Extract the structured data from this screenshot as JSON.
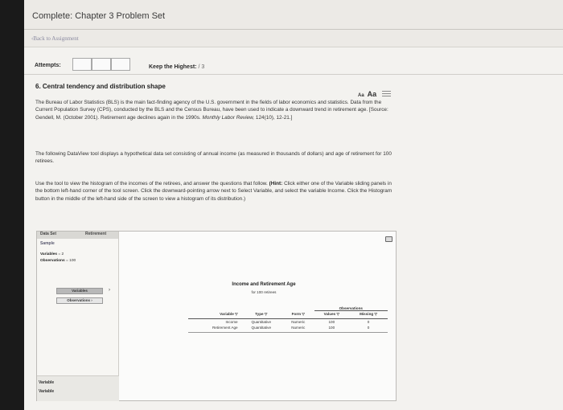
{
  "page": {
    "title": "Complete: Chapter 3 Problem Set",
    "back_link": "Back to Assignment"
  },
  "attempts": {
    "label": "Attempts:",
    "keep_label": "Keep the Highest:",
    "keep_value": "/ 3"
  },
  "question": {
    "title": "6. Central tendency and distribution shape",
    "font_small": "Aa",
    "font_big": "Aa",
    "p1_a": "The Bureau of Labor Statistics (BLS) is the main fact-finding agency of the U.S. government in the fields of labor economics and statistics. Data from the Current Population Survey (CPS), conducted by the BLS and the Census Bureau, have been used to indicate a downward trend in retirement age. [Source: Gendell, M. (October 2001). Retirement age declines again in the 1990s.",
    "p1_journal": "Monthly Labor Review,",
    "p1_b": "124(10), 12-21.]",
    "p2": "The following DataView tool displays a hypothetical data set consisting of annual income (as measured in thousands of dollars) and age of retirement for 100 retirees.",
    "p3_a": "Use the tool to view the histogram of the incomes of the retirees, and answer the questions that follow.",
    "p3_hint": "(Hint:",
    "p3_b": "Click either one of the Variable sliding panels in the bottom left-hand corner of the tool screen. Click the downward-pointing arrow next to Select Variable, and select the variable Income. Click the Histogram button in the middle of the left-hand side of the screen to view a histogram of its distribution.)"
  },
  "dataview": {
    "tab_dataset": "Data Set",
    "tab_retirement": "Retirement",
    "sample_label": "Sample",
    "variables_label": "Variables",
    "variables_value": "= 2",
    "observations_label": "Observations",
    "observations_value": "= 100",
    "btn_variables": "Variables",
    "btn_observations": "Observations",
    "arrow": "›",
    "variable_panel_1": "Variable",
    "variable_panel_2": "Variable",
    "chart_title": "Income and Retirement Age",
    "chart_subtitle": "for 100 retirees",
    "table": {
      "observations_header": "Observations",
      "headers": [
        "Variable ▽",
        "Type ▽",
        "Form ▽",
        "Values ▽",
        "Missing ▽"
      ],
      "rows": [
        [
          "Income",
          "Quantitative",
          "Numeric",
          "100",
          "0"
        ],
        [
          "Retirement Age",
          "Quantitative",
          "Numeric",
          "100",
          "0"
        ]
      ]
    }
  }
}
